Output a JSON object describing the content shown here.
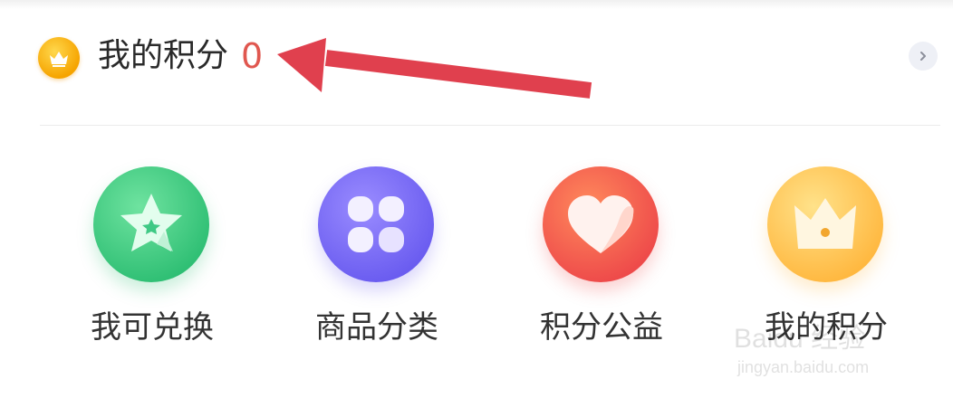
{
  "points": {
    "label": "我的积分",
    "value": "0",
    "icon": "crown-coin-icon",
    "more_icon": "chevron-right-icon"
  },
  "menu": {
    "items": [
      {
        "label": "我可兑换",
        "icon": "star-icon",
        "color": "#2fbf74"
      },
      {
        "label": "商品分类",
        "icon": "clover-icon",
        "color": "#6a5cf0"
      },
      {
        "label": "积分公益",
        "icon": "heart-icon",
        "color": "#ee4a4a"
      },
      {
        "label": "我的积分",
        "icon": "crown-icon",
        "color": "#ffb840"
      }
    ]
  },
  "annotation": {
    "color": "#e0404e"
  },
  "watermark": {
    "brand": "Baidu 经验",
    "url": "jingyan.baidu.com"
  }
}
